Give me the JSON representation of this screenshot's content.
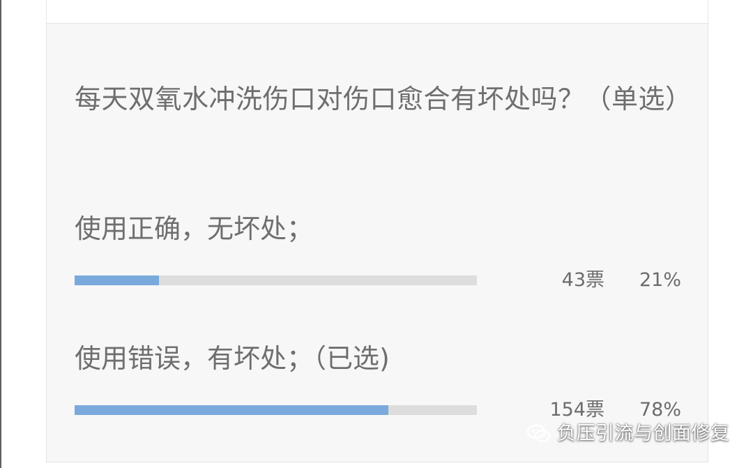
{
  "poll": {
    "question": "每天双氧水冲洗伤口对伤口愈合有坏处吗？（单选）",
    "options": [
      {
        "label": "使用正确，无坏处；",
        "votes": "43票",
        "percent": "21%",
        "fraction": 0.21
      },
      {
        "label": "使用错误，有坏处；（已选)",
        "votes": "154票",
        "percent": "78%",
        "fraction": 0.78
      }
    ]
  },
  "watermark": {
    "text": "负压引流与创面修复",
    "icon": "wechat-icon"
  },
  "colors": {
    "bar_fill": "#7aa9db",
    "bar_track": "#dddddd",
    "card_background": "#f7f7f7",
    "text": "#6e6e6e"
  }
}
